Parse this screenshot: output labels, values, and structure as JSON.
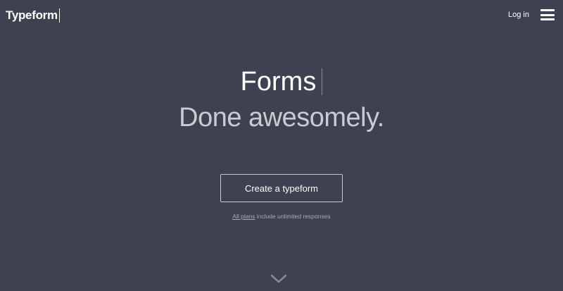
{
  "header": {
    "logo_text": "Typeform",
    "login_label": "Log in",
    "menu_icon": "hamburger-menu-icon"
  },
  "hero": {
    "headline": "Forms",
    "subheadline": "Done awesomely."
  },
  "cta": {
    "label": "Create a typeform"
  },
  "note": {
    "link_text": "All plans",
    "rest_text": " include unlimited responses"
  },
  "scroll": {
    "icon": "chevron-down-icon"
  },
  "colors": {
    "background": "#3e4250",
    "text": "#ffffff",
    "subheadline": "#c9cbd2",
    "muted": "#a7aab4"
  }
}
